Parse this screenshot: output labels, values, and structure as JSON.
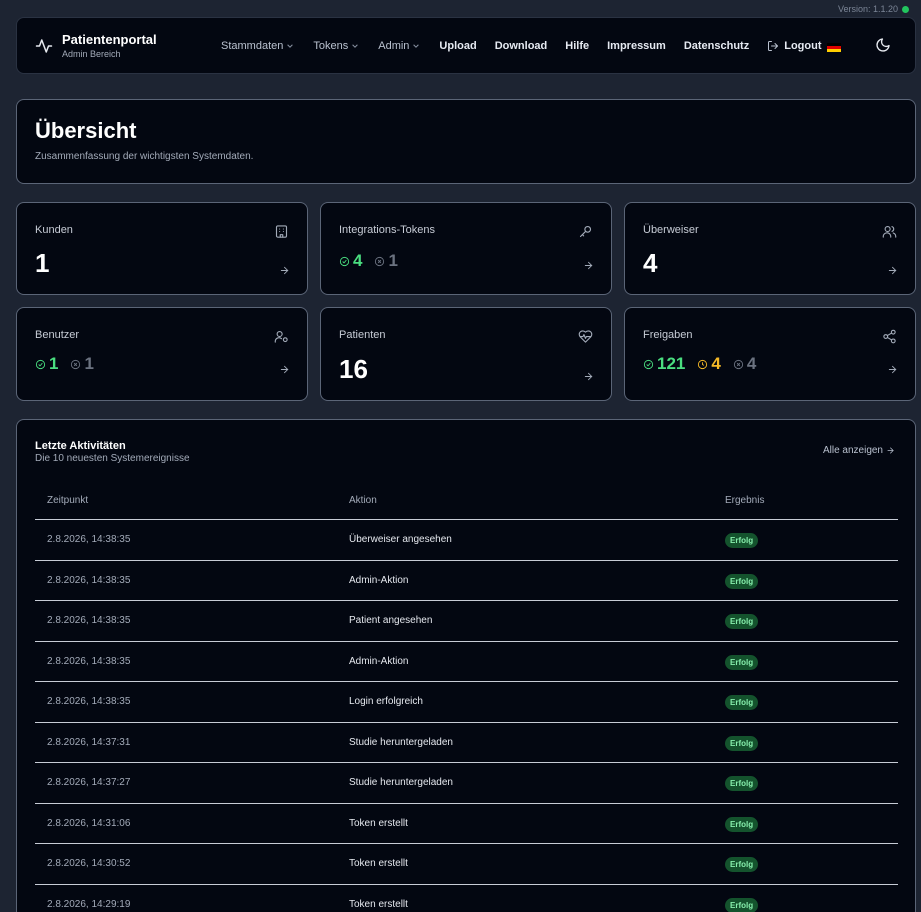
{
  "version": "Version: 1.1.20",
  "brand": {
    "title": "Patientenportal",
    "subtitle": "Admin Bereich"
  },
  "nav": [
    {
      "label": "Stammdaten",
      "dropdown": true
    },
    {
      "label": "Tokens",
      "dropdown": true
    },
    {
      "label": "Admin",
      "dropdown": true
    },
    {
      "label": "Upload",
      "dropdown": false
    },
    {
      "label": "Download",
      "dropdown": false
    },
    {
      "label": "Hilfe",
      "dropdown": false
    },
    {
      "label": "Impressum",
      "dropdown": false
    },
    {
      "label": "Datenschutz",
      "dropdown": false
    }
  ],
  "logout": "Logout",
  "overview": {
    "title": "Übersicht",
    "subtitle": "Zusammenfassung der wichtigsten Systemdaten."
  },
  "cards": {
    "kunden": {
      "title": "Kunden",
      "value": "1"
    },
    "tokens": {
      "title": "Integrations-Tokens",
      "active": "4",
      "inactive": "1"
    },
    "ueberweiser": {
      "title": "Überweiser",
      "value": "4"
    },
    "benutzer": {
      "title": "Benutzer",
      "active": "1",
      "inactive": "1"
    },
    "patienten": {
      "title": "Patienten",
      "value": "16"
    },
    "freigaben": {
      "title": "Freigaben",
      "active": "121",
      "pending": "4",
      "inactive": "4"
    }
  },
  "activity": {
    "title": "Letzte Aktivitäten",
    "subtitle": "Die 10 neuesten Systemereignisse",
    "show_all": "Alle anzeigen",
    "columns": [
      "Zeitpunkt",
      "Aktion",
      "Ergebnis"
    ],
    "rows": [
      {
        "time": "2.8.2026, 14:38:35",
        "action": "Überweiser angesehen",
        "result": "Erfolg"
      },
      {
        "time": "2.8.2026, 14:38:35",
        "action": "Admin-Aktion",
        "result": "Erfolg"
      },
      {
        "time": "2.8.2026, 14:38:35",
        "action": "Patient angesehen",
        "result": "Erfolg"
      },
      {
        "time": "2.8.2026, 14:38:35",
        "action": "Admin-Aktion",
        "result": "Erfolg"
      },
      {
        "time": "2.8.2026, 14:38:35",
        "action": "Login erfolgreich",
        "result": "Erfolg"
      },
      {
        "time": "2.8.2026, 14:37:31",
        "action": "Studie heruntergeladen",
        "result": "Erfolg"
      },
      {
        "time": "2.8.2026, 14:37:27",
        "action": "Studie heruntergeladen",
        "result": "Erfolg"
      },
      {
        "time": "2.8.2026, 14:31:06",
        "action": "Token erstellt",
        "result": "Erfolg"
      },
      {
        "time": "2.8.2026, 14:30:52",
        "action": "Token erstellt",
        "result": "Erfolg"
      },
      {
        "time": "2.8.2026, 14:29:19",
        "action": "Token erstellt",
        "result": "Erfolg"
      }
    ]
  },
  "colors": {
    "success": "#4ade80",
    "pending": "#f5b927",
    "muted": "#6b7280",
    "badge_bg": "#14532d"
  }
}
